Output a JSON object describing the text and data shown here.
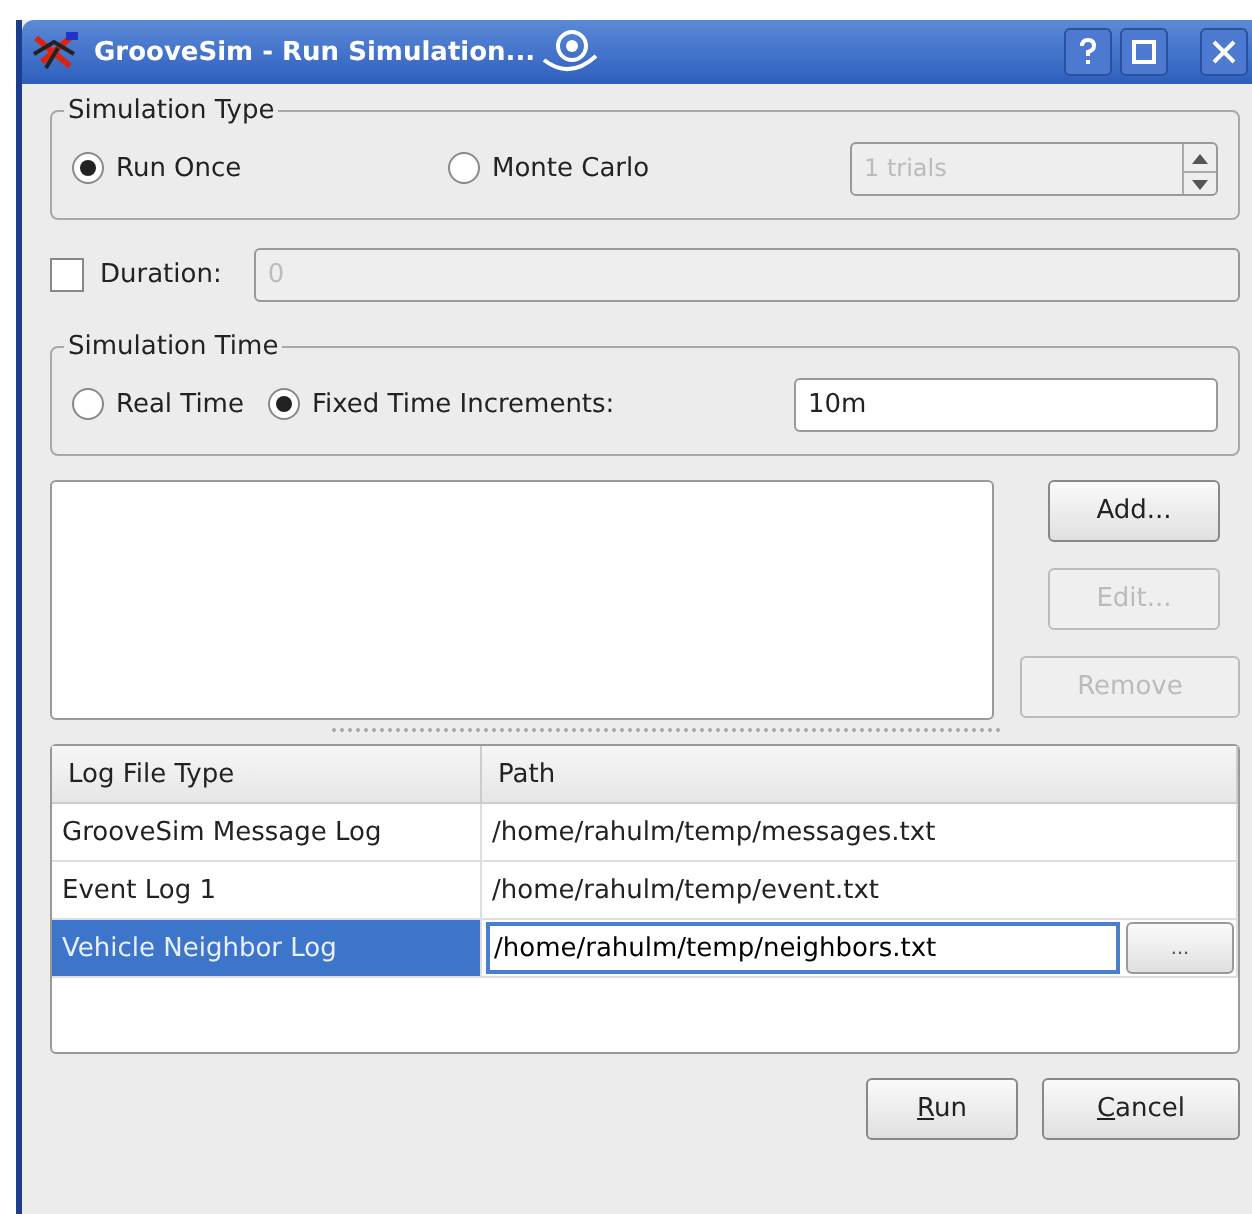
{
  "window": {
    "title": "GrooveSim - Run Simulation..."
  },
  "simulation_type": {
    "label": "Simulation Type",
    "options": [
      {
        "label": "Run Once",
        "selected": true
      },
      {
        "label": "Monte Carlo",
        "selected": false
      }
    ],
    "trials": {
      "value": "1 trials",
      "disabled": true
    }
  },
  "duration": {
    "label": "Duration:",
    "checked": false,
    "value": "0",
    "disabled": true
  },
  "simulation_time": {
    "label": "Simulation Time",
    "options": [
      {
        "label": "Real Time",
        "selected": false
      },
      {
        "label": "Fixed Time Increments:",
        "selected": true
      }
    ],
    "value": "10m"
  },
  "side_buttons": [
    {
      "label": "Add...",
      "disabled": false
    },
    {
      "label": "Edit...",
      "disabled": true
    },
    {
      "label": "Remove",
      "disabled": true
    }
  ],
  "table": {
    "columns": [
      "Log File Type",
      "Path"
    ],
    "rows": [
      {
        "type": "GrooveSim Message Log",
        "path": "/home/rahulm/temp/messages.txt",
        "selected": false,
        "editing": false
      },
      {
        "type": "Event Log 1",
        "path": "/home/rahulm/temp/event.txt",
        "selected": false,
        "editing": false
      },
      {
        "type": "Vehicle Neighbor Log",
        "path": "/home/rahulm/temp/neighbors.txt",
        "selected": true,
        "editing": true,
        "browse": "..."
      }
    ]
  },
  "buttons": [
    {
      "mnemonic": "R",
      "rest": "un"
    },
    {
      "mnemonic": "C",
      "rest": "ancel"
    }
  ]
}
